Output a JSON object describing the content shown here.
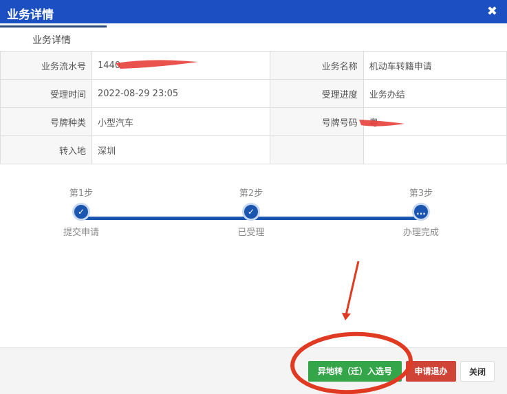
{
  "dialog": {
    "title": "业务详情",
    "close_icon": "close-icon"
  },
  "tab": {
    "label": "业务详情"
  },
  "details": [
    {
      "label": "业务流水号",
      "value": "1440",
      "label2": "业务名称",
      "value2": "机动车转籍申请"
    },
    {
      "label": "受理时间",
      "value": "2022-08-29 23:05",
      "label2": "受理进度",
      "value2": "业务办结"
    },
    {
      "label": "号牌种类",
      "value": "小型汽车",
      "label2": "号牌号码",
      "value2": "粤"
    },
    {
      "label": "转入地",
      "value": "深圳",
      "label2": "",
      "value2": ""
    }
  ],
  "steps": [
    {
      "title": "第1步",
      "name": "提交申请",
      "icon": "✓"
    },
    {
      "title": "第2步",
      "name": "已受理",
      "icon": "✓"
    },
    {
      "title": "第3步",
      "name": "办理完成",
      "icon": "..."
    }
  ],
  "buttons": {
    "transfer": "异地转（迁）入选号",
    "withdraw": "申请退办",
    "close": "关闭"
  },
  "colors": {
    "header": "#1b4fc2",
    "progress": "#1a56b0",
    "green": "#35a54a",
    "red": "#d04437",
    "annotation": "#e03a22"
  }
}
